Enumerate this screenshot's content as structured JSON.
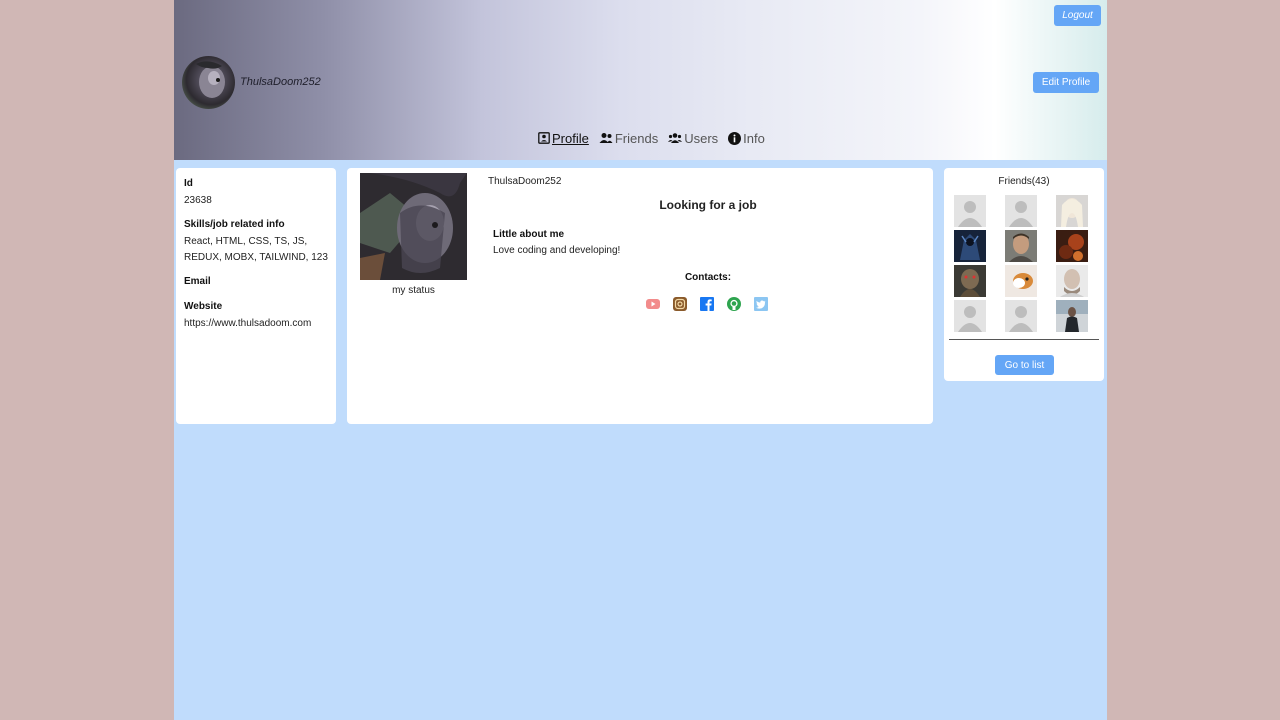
{
  "header": {
    "logout_label": "Logout",
    "edit_profile_label": "Edit Profile",
    "username": "ThulsaDoom252",
    "nav": [
      {
        "label": "Profile",
        "icon": "profile-card-icon",
        "active": true
      },
      {
        "label": "Friends",
        "icon": "friends-icon",
        "active": false
      },
      {
        "label": "Users",
        "icon": "users-icon",
        "active": false
      },
      {
        "label": "Info",
        "icon": "info-icon",
        "active": false
      }
    ]
  },
  "left_panel": {
    "id_label": "Id",
    "id_value": "23638",
    "skills_label": "Skills/job related info",
    "skills_value": "React, HTML, CSS, TS, JS, REDUX, MOBX, TAILWIND, 123",
    "email_label": "Email",
    "website_label": "Website",
    "website_value": "https://www.thulsadoom.com"
  },
  "center_panel": {
    "photo_caption": "my status",
    "username": "ThulsaDoom252",
    "job_status": "Looking for a job",
    "about_label": "Little about me",
    "about_text": "Love coding and developing!",
    "contacts_label": "Contacts:",
    "contacts": [
      {
        "name": "youtube-icon",
        "color": "#f28b8b"
      },
      {
        "name": "instagram-icon",
        "color": "#8a5a2b"
      },
      {
        "name": "facebook-icon",
        "color": "#1877f2"
      },
      {
        "name": "github-icon",
        "color": "#2ea44f"
      },
      {
        "name": "twitter-icon",
        "color": "#8cc6f2"
      }
    ]
  },
  "right_panel": {
    "friends_title": "Friends(43)",
    "go_to_list_label": "Go to list"
  },
  "colors": {
    "accent": "#64a6f6",
    "page_bg": "#c0dcfc",
    "outer_bg": "#d0b7b5"
  }
}
